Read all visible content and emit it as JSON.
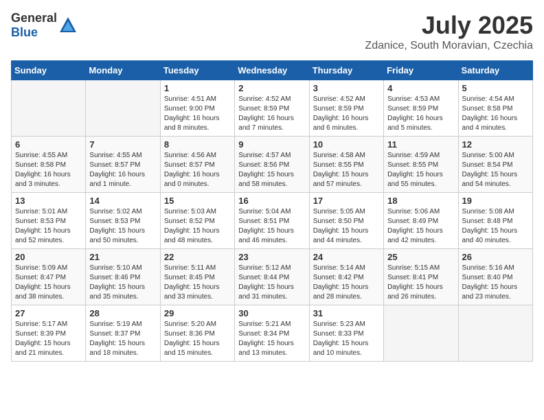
{
  "header": {
    "logo_general": "General",
    "logo_blue": "Blue",
    "title": "July 2025",
    "location": "Zdanice, South Moravian, Czechia"
  },
  "weekdays": [
    "Sunday",
    "Monday",
    "Tuesday",
    "Wednesday",
    "Thursday",
    "Friday",
    "Saturday"
  ],
  "weeks": [
    [
      {
        "day": "",
        "info": ""
      },
      {
        "day": "",
        "info": ""
      },
      {
        "day": "1",
        "info": "Sunrise: 4:51 AM\nSunset: 9:00 PM\nDaylight: 16 hours\nand 8 minutes."
      },
      {
        "day": "2",
        "info": "Sunrise: 4:52 AM\nSunset: 8:59 PM\nDaylight: 16 hours\nand 7 minutes."
      },
      {
        "day": "3",
        "info": "Sunrise: 4:52 AM\nSunset: 8:59 PM\nDaylight: 16 hours\nand 6 minutes."
      },
      {
        "day": "4",
        "info": "Sunrise: 4:53 AM\nSunset: 8:59 PM\nDaylight: 16 hours\nand 5 minutes."
      },
      {
        "day": "5",
        "info": "Sunrise: 4:54 AM\nSunset: 8:58 PM\nDaylight: 16 hours\nand 4 minutes."
      }
    ],
    [
      {
        "day": "6",
        "info": "Sunrise: 4:55 AM\nSunset: 8:58 PM\nDaylight: 16 hours\nand 3 minutes."
      },
      {
        "day": "7",
        "info": "Sunrise: 4:55 AM\nSunset: 8:57 PM\nDaylight: 16 hours\nand 1 minute."
      },
      {
        "day": "8",
        "info": "Sunrise: 4:56 AM\nSunset: 8:57 PM\nDaylight: 16 hours\nand 0 minutes."
      },
      {
        "day": "9",
        "info": "Sunrise: 4:57 AM\nSunset: 8:56 PM\nDaylight: 15 hours\nand 58 minutes."
      },
      {
        "day": "10",
        "info": "Sunrise: 4:58 AM\nSunset: 8:55 PM\nDaylight: 15 hours\nand 57 minutes."
      },
      {
        "day": "11",
        "info": "Sunrise: 4:59 AM\nSunset: 8:55 PM\nDaylight: 15 hours\nand 55 minutes."
      },
      {
        "day": "12",
        "info": "Sunrise: 5:00 AM\nSunset: 8:54 PM\nDaylight: 15 hours\nand 54 minutes."
      }
    ],
    [
      {
        "day": "13",
        "info": "Sunrise: 5:01 AM\nSunset: 8:53 PM\nDaylight: 15 hours\nand 52 minutes."
      },
      {
        "day": "14",
        "info": "Sunrise: 5:02 AM\nSunset: 8:53 PM\nDaylight: 15 hours\nand 50 minutes."
      },
      {
        "day": "15",
        "info": "Sunrise: 5:03 AM\nSunset: 8:52 PM\nDaylight: 15 hours\nand 48 minutes."
      },
      {
        "day": "16",
        "info": "Sunrise: 5:04 AM\nSunset: 8:51 PM\nDaylight: 15 hours\nand 46 minutes."
      },
      {
        "day": "17",
        "info": "Sunrise: 5:05 AM\nSunset: 8:50 PM\nDaylight: 15 hours\nand 44 minutes."
      },
      {
        "day": "18",
        "info": "Sunrise: 5:06 AM\nSunset: 8:49 PM\nDaylight: 15 hours\nand 42 minutes."
      },
      {
        "day": "19",
        "info": "Sunrise: 5:08 AM\nSunset: 8:48 PM\nDaylight: 15 hours\nand 40 minutes."
      }
    ],
    [
      {
        "day": "20",
        "info": "Sunrise: 5:09 AM\nSunset: 8:47 PM\nDaylight: 15 hours\nand 38 minutes."
      },
      {
        "day": "21",
        "info": "Sunrise: 5:10 AM\nSunset: 8:46 PM\nDaylight: 15 hours\nand 35 minutes."
      },
      {
        "day": "22",
        "info": "Sunrise: 5:11 AM\nSunset: 8:45 PM\nDaylight: 15 hours\nand 33 minutes."
      },
      {
        "day": "23",
        "info": "Sunrise: 5:12 AM\nSunset: 8:44 PM\nDaylight: 15 hours\nand 31 minutes."
      },
      {
        "day": "24",
        "info": "Sunrise: 5:14 AM\nSunset: 8:42 PM\nDaylight: 15 hours\nand 28 minutes."
      },
      {
        "day": "25",
        "info": "Sunrise: 5:15 AM\nSunset: 8:41 PM\nDaylight: 15 hours\nand 26 minutes."
      },
      {
        "day": "26",
        "info": "Sunrise: 5:16 AM\nSunset: 8:40 PM\nDaylight: 15 hours\nand 23 minutes."
      }
    ],
    [
      {
        "day": "27",
        "info": "Sunrise: 5:17 AM\nSunset: 8:39 PM\nDaylight: 15 hours\nand 21 minutes."
      },
      {
        "day": "28",
        "info": "Sunrise: 5:19 AM\nSunset: 8:37 PM\nDaylight: 15 hours\nand 18 minutes."
      },
      {
        "day": "29",
        "info": "Sunrise: 5:20 AM\nSunset: 8:36 PM\nDaylight: 15 hours\nand 15 minutes."
      },
      {
        "day": "30",
        "info": "Sunrise: 5:21 AM\nSunset: 8:34 PM\nDaylight: 15 hours\nand 13 minutes."
      },
      {
        "day": "31",
        "info": "Sunrise: 5:23 AM\nSunset: 8:33 PM\nDaylight: 15 hours\nand 10 minutes."
      },
      {
        "day": "",
        "info": ""
      },
      {
        "day": "",
        "info": ""
      }
    ]
  ],
  "row_shading": [
    false,
    true,
    false,
    true,
    false
  ]
}
